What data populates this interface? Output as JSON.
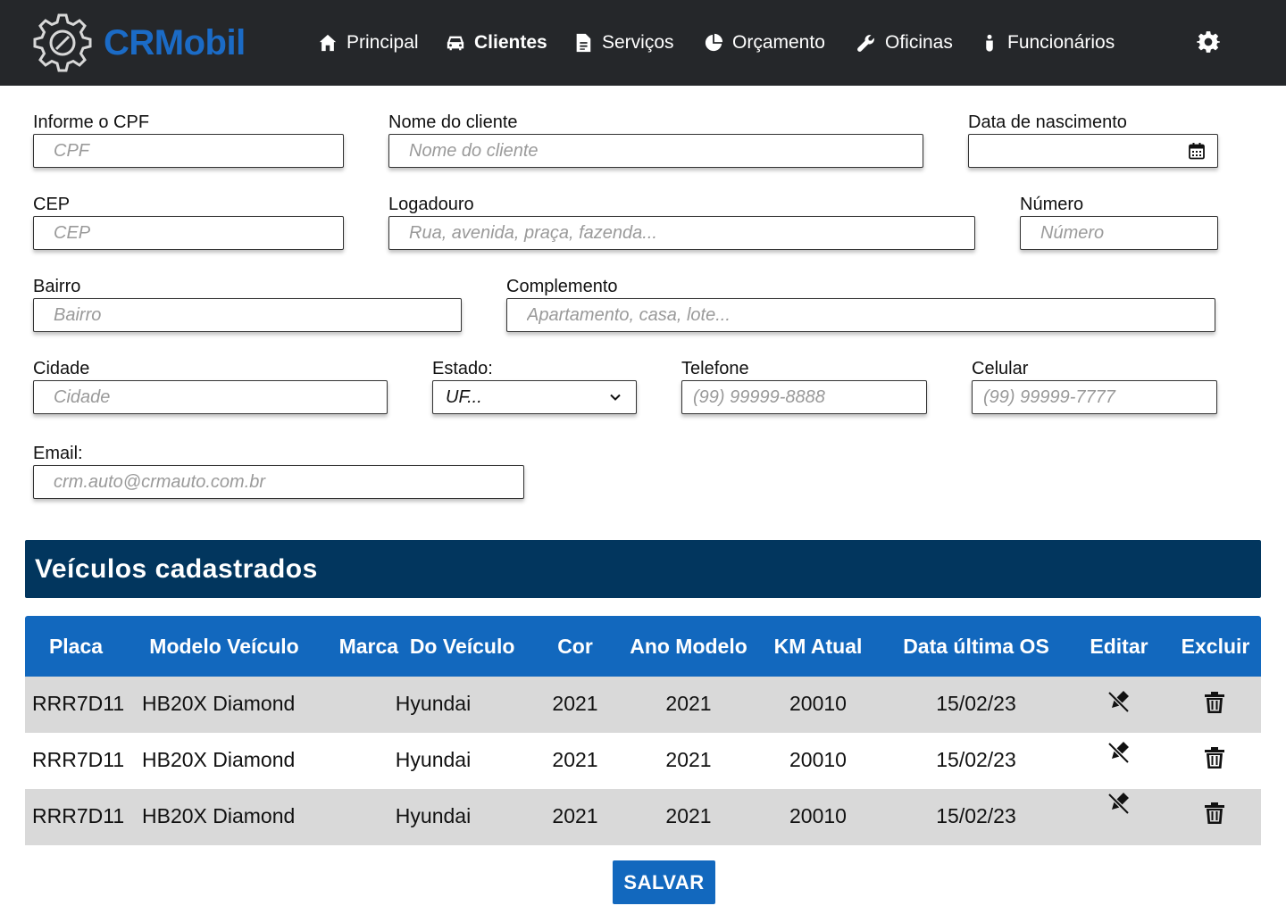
{
  "header": {
    "brand": "CRMobil",
    "brand_color": "#1b6bc6",
    "background": "#25272a",
    "nav": [
      {
        "label": "Principal",
        "icon": "home-icon",
        "active": false
      },
      {
        "label": "Clientes",
        "icon": "car-icon",
        "active": true
      },
      {
        "label": "Serviços",
        "icon": "document-icon",
        "active": false
      },
      {
        "label": "Orçamento",
        "icon": "pie-chart-icon",
        "active": false
      },
      {
        "label": "Oficinas",
        "icon": "wrench-icon",
        "active": false
      },
      {
        "label": "Funcionários",
        "icon": "person-icon",
        "active": false
      }
    ],
    "settings_icon": "gear-icon"
  },
  "form": {
    "cpf": {
      "label": "Informe o CPF",
      "placeholder": "CPF"
    },
    "nome": {
      "label": "Nome do cliente",
      "placeholder": "Nome do cliente"
    },
    "nascimento": {
      "label": "Data de nascimento",
      "icon": "calendar-icon"
    },
    "cep": {
      "label": "CEP",
      "placeholder": "CEP"
    },
    "logradouro": {
      "label": "Logadouro",
      "placeholder": "Rua, avenida, praça, fazenda..."
    },
    "numero": {
      "label": "Número",
      "placeholder": "Número"
    },
    "bairro": {
      "label": "Bairro",
      "placeholder": "Bairro"
    },
    "complemento": {
      "label": "Complemento",
      "placeholder": "Apartamento, casa, lote..."
    },
    "cidade": {
      "label": "Cidade",
      "placeholder": "Cidade"
    },
    "estado": {
      "label": "Estado:",
      "value": "UF..."
    },
    "telefone": {
      "label": "Telefone",
      "placeholder": "(99) 99999-8888"
    },
    "celular": {
      "label": "Celular",
      "placeholder": "(99) 99999-7777"
    },
    "email": {
      "label": "Email:",
      "placeholder": "crm.auto@crmauto.com.br"
    }
  },
  "vehicles": {
    "title": "Veículos cadastrados",
    "title_bg": "#02365e",
    "header_bg": "#1268be",
    "columns": [
      "Placa",
      "Modelo Veículo",
      "Marca  Do Veículo",
      "Cor",
      "Ano Modelo",
      "KM Atual",
      "Data última OS",
      "Editar",
      "Excluir"
    ],
    "rows": [
      {
        "placa": "RRR7D11",
        "modelo": "HB20X Diamond",
        "marca": "Hyundai",
        "cor": "2021",
        "ano": "2021",
        "km": "20010",
        "data": "15/02/23"
      },
      {
        "placa": "RRR7D11",
        "modelo": "HB20X Diamond",
        "marca": "Hyundai",
        "cor": "2021",
        "ano": "2021",
        "km": "20010",
        "data": "15/02/23"
      },
      {
        "placa": "RRR7D11",
        "modelo": "HB20X Diamond",
        "marca": "Hyundai",
        "cor": "2021",
        "ano": "2021",
        "km": "20010",
        "data": "15/02/23"
      }
    ],
    "edit_icon": "edit-off-icon",
    "delete_icon": "trash-icon"
  },
  "actions": {
    "save_label": "SALVAR"
  }
}
